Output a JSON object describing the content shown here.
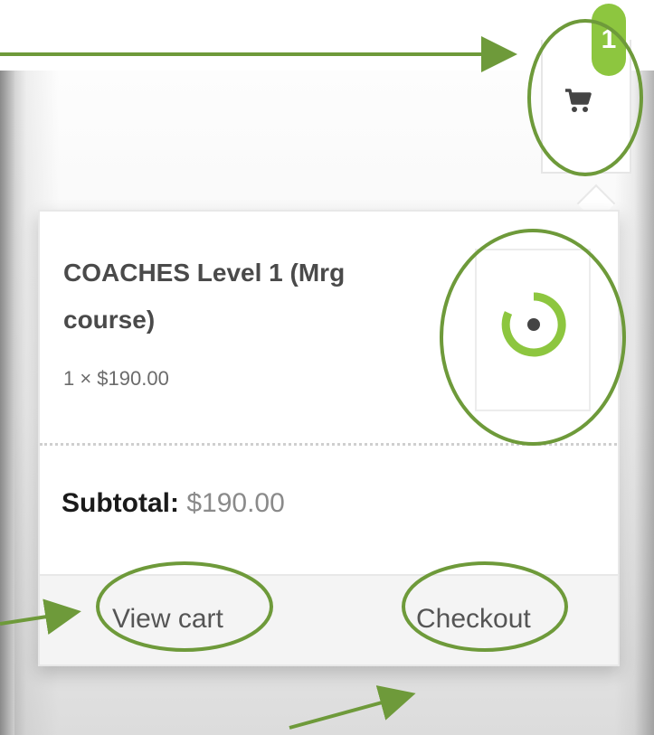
{
  "header": {
    "cart_count": "1",
    "cart_icon": "shopping-cart-icon"
  },
  "cart": {
    "item": {
      "title_line1": "COACHES Level 1 (Mrg",
      "title_line2": "course)",
      "quantity_price": "1 × $190.00",
      "thumbnail_icon": "brand-logo-icon"
    },
    "subtotal_label": "Subtotal:",
    "subtotal_value": "$190.00",
    "view_cart_label": "View cart",
    "checkout_label": "Checkout"
  },
  "colors": {
    "accent_green": "#8dc63f",
    "annotation_green": "#6e9a3a",
    "text_dark": "#4a4a4a"
  }
}
